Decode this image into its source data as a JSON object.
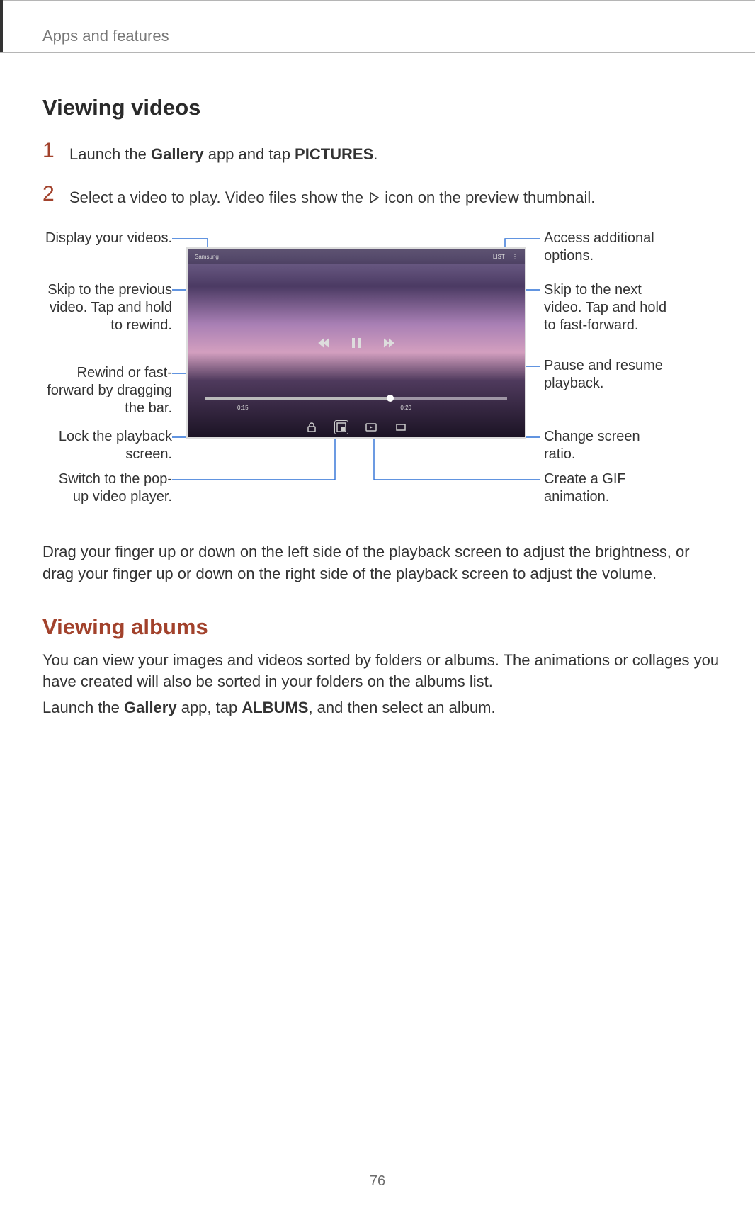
{
  "breadcrumb": "Apps and features",
  "section1_title": "Viewing videos",
  "step1_num": "1",
  "step1_pre": "Launch the ",
  "step1_b1": "Gallery",
  "step1_mid": " app and tap ",
  "step1_b2": "PICTURES",
  "step1_post": ".",
  "step2_num": "2",
  "step2_pre": "Select a video to play. Video files show the ",
  "step2_post": " icon on the preview thumbnail.",
  "video": {
    "brand": "Samsung",
    "list": "LIST",
    "more": "⋮",
    "time_left": "0:15",
    "time_right": "0:20"
  },
  "callouts": {
    "left1": "Display your videos.",
    "left2": "Skip to the previous video. Tap and hold to rewind.",
    "left3": "Rewind or fast-forward by dragging the bar.",
    "left4": "Lock the playback screen.",
    "left5": "Switch to the pop-up video player.",
    "right1": "Access additional options.",
    "right2": "Skip to the next video. Tap and hold to fast-forward.",
    "right3": "Pause and resume playback.",
    "right4": "Change screen ratio.",
    "right5": "Create a GIF animation."
  },
  "drag_para": "Drag your finger up or down on the left side of the playback screen to adjust the brightness, or drag your finger up or down on the right side of the playback screen to adjust the volume.",
  "section2_title": "Viewing albums",
  "albums_p1": "You can view your images and videos sorted by folders or albums. The animations or collages you have created will also be sorted in your folders on the albums list.",
  "albums_p2_pre": "Launch the ",
  "albums_p2_b1": "Gallery",
  "albums_p2_mid": " app, tap ",
  "albums_p2_b2": "ALBUMS",
  "albums_p2_post": ", and then select an album.",
  "page_number": "76"
}
